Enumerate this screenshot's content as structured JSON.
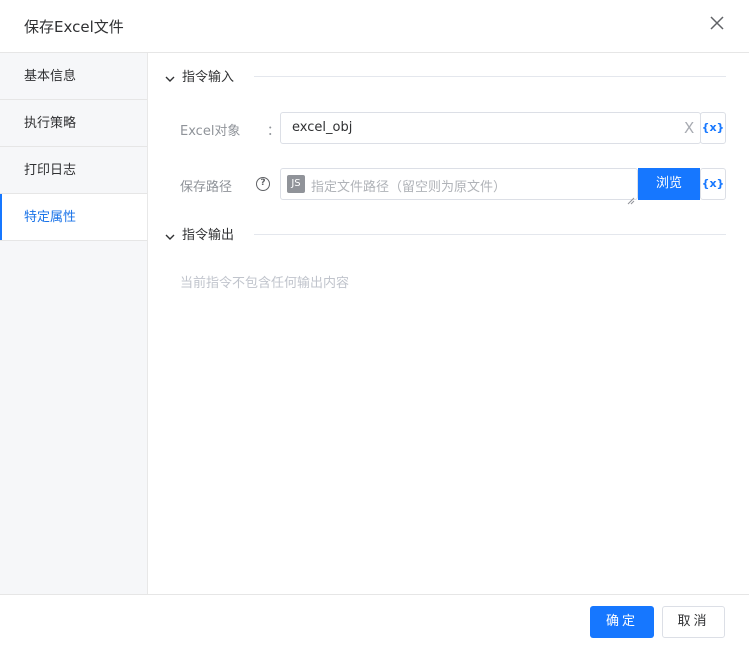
{
  "dialog": {
    "title": "保存Excel文件",
    "close_icon": "close-icon"
  },
  "sidebar": {
    "items": [
      {
        "label": "基本信息"
      },
      {
        "label": "执行策略"
      },
      {
        "label": "打印日志"
      },
      {
        "label": "特定属性"
      }
    ],
    "active_index": 3
  },
  "sections": {
    "input": {
      "title": "指令输入",
      "fields": {
        "excel_obj": {
          "label": "Excel对象",
          "colon": "：",
          "value": "excel_obj",
          "clear_glyph": "X",
          "var_label": "{x}"
        },
        "save_path": {
          "label": "保存路径",
          "help_glyph": "?",
          "badge": "JS",
          "placeholder": "指定文件路径（留空则为原文件）",
          "browse_label": "浏览",
          "var_label": "{x}"
        }
      }
    },
    "output": {
      "title": "指令输出",
      "empty_text": "当前指令不包含任何输出内容"
    }
  },
  "footer": {
    "confirm_label": "确定",
    "cancel_label": "取消"
  },
  "colors": {
    "primary": "#1677ff",
    "sidebar_bg": "#f6f7f9",
    "border": "#dcdfe6"
  }
}
